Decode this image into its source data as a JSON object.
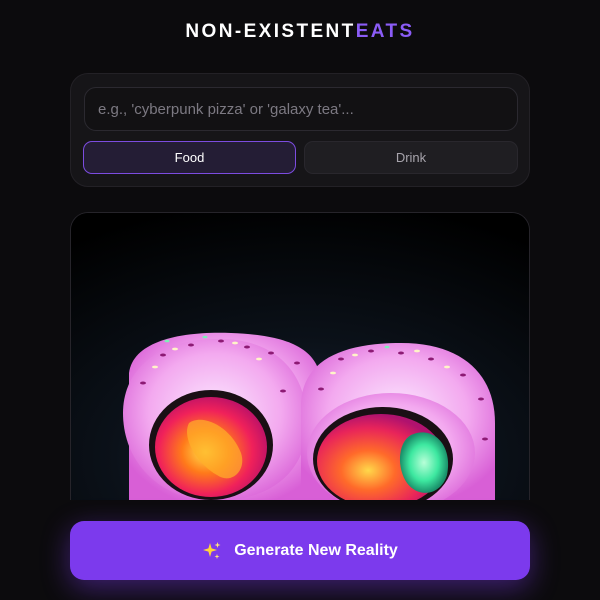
{
  "header": {
    "brand_part1": "NON-EXISTENT",
    "brand_part2": "EATS"
  },
  "search": {
    "placeholder": "e.g., 'cyberpunk pizza' or 'galaxy tea'...",
    "value": ""
  },
  "category_toggle": {
    "options": [
      {
        "label": "Food",
        "selected": true
      },
      {
        "label": "Drink",
        "selected": false
      }
    ]
  },
  "preview": {
    "icon": "generated-food-image",
    "alt": "sushi roll"
  },
  "generate_button": {
    "label": "Generate New Reality",
    "icon": "sparkles-icon"
  },
  "colors": {
    "accent": "#7c3aed",
    "accent_text": "#8b5cf6",
    "background": "#0c0b0d"
  }
}
